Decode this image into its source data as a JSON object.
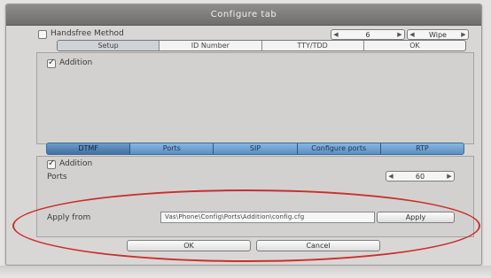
{
  "window": {
    "title": "Configure tab"
  },
  "top": {
    "checkbox_label": "Handsfree Method",
    "checkbox_checked": false,
    "stepper_value": "6",
    "mode_value": "Wipe"
  },
  "tabs_upper": [
    "Setup",
    "ID Number",
    "TTY/TDD",
    "OK"
  ],
  "tabs_upper_selected": 0,
  "upper_panel": {
    "checkbox_label": "Addition",
    "checkbox_checked": true
  },
  "tabs_lower": [
    "DTMF",
    "Ports",
    "SIP",
    "Configure ports",
    "RTP"
  ],
  "tabs_lower_selected": 0,
  "lower_panel": {
    "checkbox_label": "Addition",
    "checkbox_checked": true,
    "field_label": "Ports",
    "ports_value": "60"
  },
  "apply": {
    "label": "Apply from",
    "path": "Vas\\Phone\\Config\\Ports\\Addition\\config.cfg",
    "button": "Apply"
  },
  "footer": {
    "ok": "OK",
    "cancel": "Cancel"
  },
  "colors": {
    "tab_blue": "#5f95c9",
    "highlight_ring": "#c9302c"
  }
}
